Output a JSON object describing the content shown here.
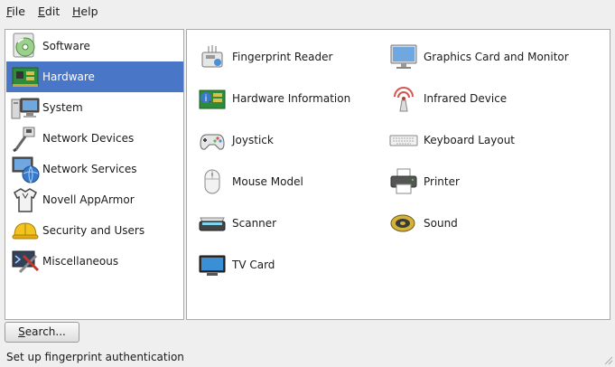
{
  "menu": {
    "file": {
      "mnemonic": "F",
      "rest": "ile"
    },
    "edit": {
      "mnemonic": "E",
      "rest": "dit"
    },
    "help": {
      "mnemonic": "H",
      "rest": "elp"
    }
  },
  "sidebar": {
    "selected": "Hardware",
    "items": [
      {
        "label": "Software",
        "icon": "software-cd-icon"
      },
      {
        "label": "Hardware",
        "icon": "hardware-board-icon"
      },
      {
        "label": "System",
        "icon": "system-computer-icon"
      },
      {
        "label": "Network Devices",
        "icon": "network-plug-icon"
      },
      {
        "label": "Network Services",
        "icon": "network-globe-icon"
      },
      {
        "label": "Novell AppArmor",
        "icon": "apparmor-shirt-icon"
      },
      {
        "label": "Security and Users",
        "icon": "security-helmet-icon"
      },
      {
        "label": "Miscellaneous",
        "icon": "misc-tools-icon"
      }
    ]
  },
  "modules": [
    {
      "label": "Fingerprint Reader",
      "icon": "fingerprint-reader-icon"
    },
    {
      "label": "Graphics Card and Monitor",
      "icon": "monitor-icon"
    },
    {
      "label": "Hardware Information",
      "icon": "hardware-info-icon"
    },
    {
      "label": "Infrared Device",
      "icon": "infrared-icon"
    },
    {
      "label": "Joystick",
      "icon": "joystick-icon"
    },
    {
      "label": "Keyboard Layout",
      "icon": "keyboard-icon"
    },
    {
      "label": "Mouse Model",
      "icon": "mouse-icon"
    },
    {
      "label": "Printer",
      "icon": "printer-icon"
    },
    {
      "label": "Scanner",
      "icon": "scanner-icon"
    },
    {
      "label": "Sound",
      "icon": "sound-speaker-icon"
    },
    {
      "label": "TV Card",
      "icon": "tv-card-icon"
    }
  ],
  "search_button": {
    "mnemonic": "S",
    "rest": "earch..."
  },
  "status": "Set up fingerprint authentication",
  "colors": {
    "selection": "#4a76c7",
    "window_bg": "#efefef",
    "panel_bg": "#ffffff"
  }
}
